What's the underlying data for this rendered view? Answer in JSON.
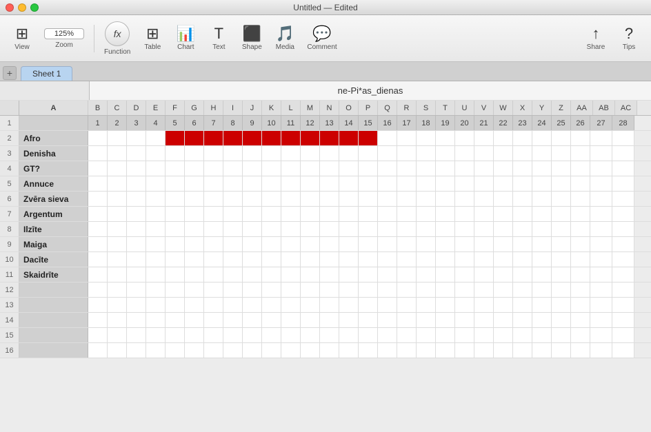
{
  "window": {
    "title": "Untitled — Edited"
  },
  "toolbar": {
    "view_label": "View",
    "zoom_value": "125%",
    "zoom_label": "Zoom",
    "function_label": "Function",
    "table_label": "Table",
    "chart_label": "Chart",
    "text_label": "Text",
    "shape_label": "Shape",
    "media_label": "Media",
    "comment_label": "Comment",
    "share_label": "Share",
    "tips_label": "Tips"
  },
  "sheet": {
    "tab_name": "Sheet 1",
    "title": "ne-Pi*as_dienas"
  },
  "col_letters": [
    "A",
    "B",
    "C",
    "D",
    "E",
    "F",
    "G",
    "H",
    "I",
    "J",
    "K",
    "L",
    "M",
    "N",
    "O",
    "P",
    "Q",
    "R",
    "S",
    "T",
    "U",
    "V",
    "W",
    "X",
    "Y",
    "Z",
    "AA",
    "AB",
    "AC"
  ],
  "col_numbers": [
    "",
    "1",
    "2",
    "3",
    "4",
    "5",
    "6",
    "7",
    "8",
    "9",
    "10",
    "11",
    "12",
    "13",
    "14",
    "15",
    "16",
    "17",
    "18",
    "19",
    "20",
    "21",
    "22",
    "23",
    "24",
    "25",
    "26",
    "27",
    "28"
  ],
  "rows": [
    {
      "num": "2",
      "name": "Afro",
      "red_cols": [
        5,
        6,
        7,
        8,
        9,
        10,
        11,
        12,
        13,
        14,
        15
      ]
    },
    {
      "num": "3",
      "name": "Denisha",
      "red_cols": []
    },
    {
      "num": "4",
      "name": "GT?",
      "red_cols": []
    },
    {
      "num": "5",
      "name": "Annuce",
      "red_cols": []
    },
    {
      "num": "6",
      "name": "Zvēra sieva",
      "red_cols": []
    },
    {
      "num": "7",
      "name": "Argentum",
      "red_cols": []
    },
    {
      "num": "8",
      "name": "Ilzīte",
      "red_cols": []
    },
    {
      "num": "9",
      "name": "Maiga",
      "red_cols": []
    },
    {
      "num": "10",
      "name": "Dacīte",
      "red_cols": []
    },
    {
      "num": "11",
      "name": "Skaidrīte",
      "red_cols": []
    },
    {
      "num": "12",
      "name": "",
      "red_cols": []
    },
    {
      "num": "13",
      "name": "",
      "red_cols": []
    },
    {
      "num": "14",
      "name": "",
      "red_cols": []
    },
    {
      "num": "15",
      "name": "",
      "red_cols": []
    },
    {
      "num": "16",
      "name": "",
      "red_cols": []
    }
  ]
}
